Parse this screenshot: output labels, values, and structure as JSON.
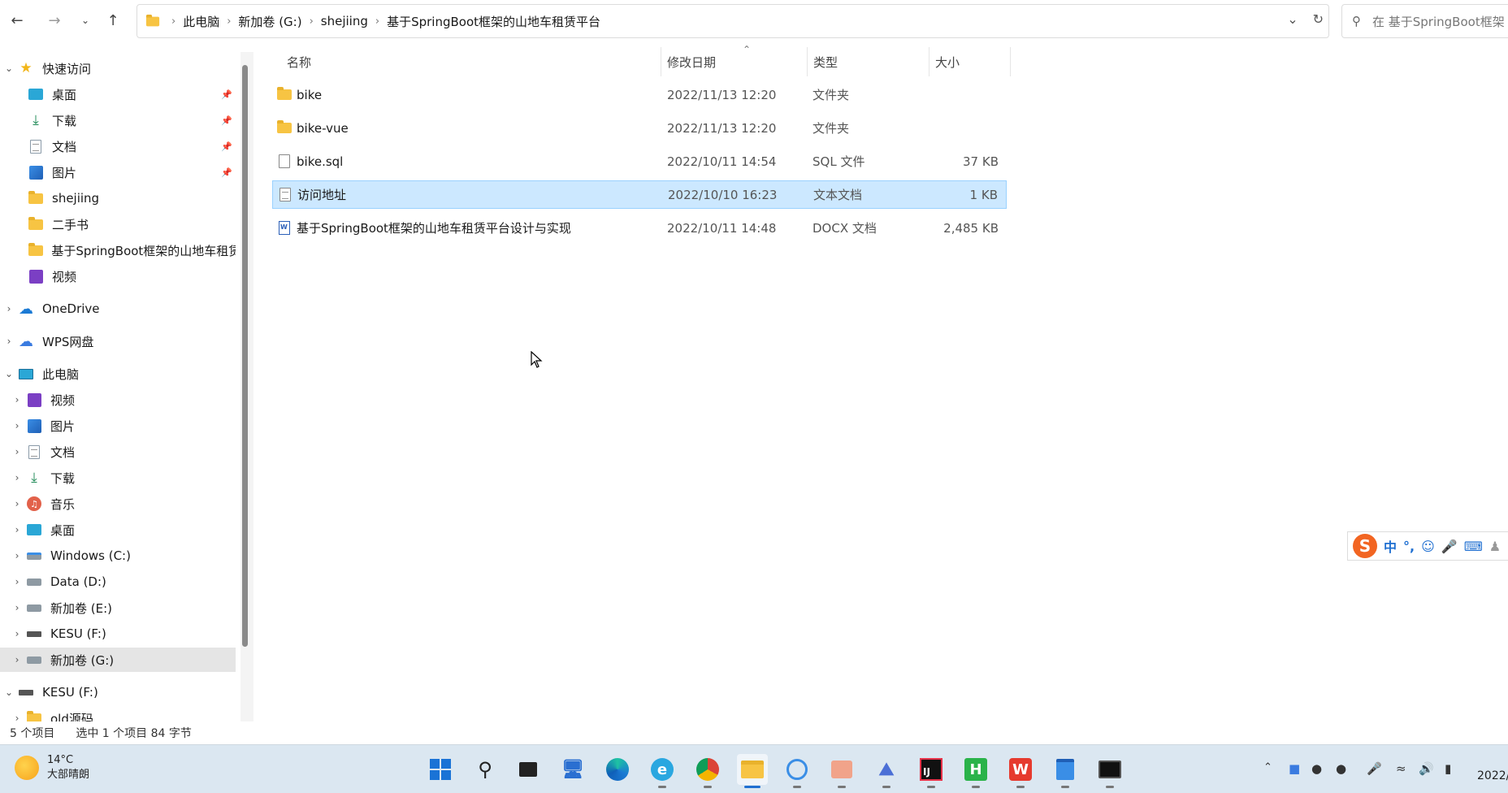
{
  "address_bar": {
    "breadcrumbs": [
      "此电脑",
      "新加卷 (G:)",
      "shejiing",
      "基于SpringBoot框架的山地车租赁平台"
    ]
  },
  "search": {
    "placeholder": "在 基于SpringBoot框架"
  },
  "sidebar": {
    "quick_access": {
      "label": "快速访问",
      "items": [
        {
          "label": "桌面",
          "icon": "desktop-icon",
          "pinned": true
        },
        {
          "label": "下载",
          "icon": "download-icon",
          "pinned": true
        },
        {
          "label": "文档",
          "icon": "document-icon",
          "pinned": true
        },
        {
          "label": "图片",
          "icon": "pictures-icon",
          "pinned": true
        },
        {
          "label": "shejiing",
          "icon": "folder-icon",
          "pinned": false
        },
        {
          "label": "二手书",
          "icon": "folder-icon",
          "pinned": false
        },
        {
          "label": "基于SpringBoot框架的山地车租赁",
          "icon": "folder-icon",
          "pinned": false
        },
        {
          "label": "视频",
          "icon": "videos-icon",
          "pinned": false
        }
      ]
    },
    "onedrive": "OneDrive",
    "wps": "WPS网盘",
    "this_pc": {
      "label": "此电脑",
      "items": [
        {
          "label": "视频",
          "icon": "videos-icon"
        },
        {
          "label": "图片",
          "icon": "pictures-icon"
        },
        {
          "label": "文档",
          "icon": "document-icon"
        },
        {
          "label": "下载",
          "icon": "download-icon"
        },
        {
          "label": "音乐",
          "icon": "music-icon"
        },
        {
          "label": "桌面",
          "icon": "desktop-icon"
        },
        {
          "label": "Windows (C:)",
          "icon": "drive-icon"
        },
        {
          "label": "Data (D:)",
          "icon": "drive-icon"
        },
        {
          "label": "新加卷 (E:)",
          "icon": "drive-icon"
        },
        {
          "label": "KESU  (F:)",
          "icon": "usb-drive-icon"
        },
        {
          "label": "新加卷 (G:)",
          "icon": "drive-icon",
          "selected": true
        }
      ]
    },
    "kesu": {
      "label": "KESU  (F:)",
      "child": "old源码"
    }
  },
  "columns": {
    "name": "名称",
    "date": "修改日期",
    "type": "类型",
    "size": "大小"
  },
  "files": [
    {
      "name": "bike",
      "date": "2022/11/13 12:20",
      "type": "文件夹",
      "size": "",
      "icon": "folder-icon"
    },
    {
      "name": "bike-vue",
      "date": "2022/11/13 12:20",
      "type": "文件夹",
      "size": "",
      "icon": "folder-icon"
    },
    {
      "name": "bike.sql",
      "date": "2022/10/11 14:54",
      "type": "SQL 文件",
      "size": "37 KB",
      "icon": "sql-file-icon"
    },
    {
      "name": "访问地址",
      "date": "2022/10/10 16:23",
      "type": "文本文档",
      "size": "1 KB",
      "icon": "text-file-icon",
      "selected": true
    },
    {
      "name": "基于SpringBoot框架的山地车租赁平台设计与实现",
      "date": "2022/10/11 14:48",
      "type": "DOCX 文档",
      "size": "2,485 KB",
      "icon": "word-file-icon"
    }
  ],
  "status": {
    "count": "5 个项目",
    "selection": "选中 1 个项目  84 字节"
  },
  "ime": {
    "mode": "中"
  },
  "taskbar": {
    "weather": {
      "temp": "14°C",
      "desc": "大部晴朗"
    },
    "clock": "2022/"
  },
  "colors": {
    "selection": "#cce8ff",
    "taskbar": "#dbe7f1",
    "accent": "#1f6fd1"
  }
}
